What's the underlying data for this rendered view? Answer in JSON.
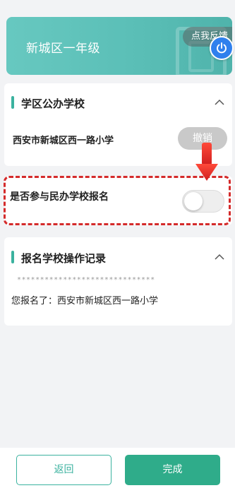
{
  "banner": {
    "title": "新城区一年级",
    "feedback_label": "点我反馈"
  },
  "public_school_section": {
    "title": "学区公办学校",
    "school_name": "西安市新城区西一路小学",
    "cancel_label": "撤销"
  },
  "private_school_row": {
    "label": "是否参与民办学校报名",
    "toggle_on": false
  },
  "record_section": {
    "title": "报名学校操作记录",
    "masked_line": "******************************",
    "record_text": "您报名了：西安市新城区西一路小学"
  },
  "footer": {
    "back_label": "返回",
    "done_label": "完成"
  },
  "colors": {
    "accent": "#3bb29f",
    "primary_button": "#2fac8a",
    "highlight": "#d42b2b",
    "power_button": "#2f80ed"
  },
  "icons": {
    "power": "power-icon",
    "collapse": "chevron-up-icon",
    "pointer": "red-arrow-down-icon"
  }
}
